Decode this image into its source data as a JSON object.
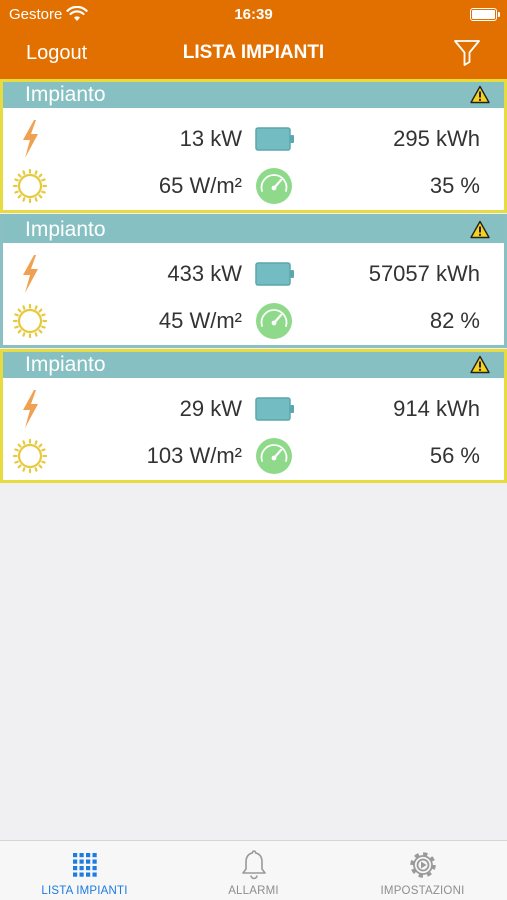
{
  "status_bar": {
    "carrier": "Gestore",
    "time": "16:39"
  },
  "header": {
    "logout_label": "Logout",
    "title": "LISTA IMPIANTI"
  },
  "colors": {
    "header_bg": "#e27000",
    "card_header_bg": "#86c0c3",
    "card_border_warning": "#e6dc3f",
    "bolt": "#f0a052",
    "sun": "#e6c93c",
    "battery": "#73bcc1",
    "gauge": "#8fd98a",
    "tab_active": "#1e7be0"
  },
  "plants": [
    {
      "name": "Impianto",
      "power": "13 kW",
      "energy": "295 kWh",
      "irradiance": "65 W/m²",
      "performance": "35 %",
      "warning": true
    },
    {
      "name": "Impianto",
      "power": "433 kW",
      "energy": "57057 kWh",
      "irradiance": "45 W/m²",
      "performance": "82 %",
      "warning": true
    },
    {
      "name": "Impianto",
      "power": "29 kW",
      "energy": "914 kWh",
      "irradiance": "103 W/m²",
      "performance": "56 %",
      "warning": true
    }
  ],
  "tabbar": {
    "tabs": [
      {
        "label": "LISTA IMPIANTI",
        "icon": "grid-icon",
        "active": true
      },
      {
        "label": "ALLARMI",
        "icon": "bell-icon",
        "active": false
      },
      {
        "label": "IMPOSTAZIONI",
        "icon": "gear-icon",
        "active": false
      }
    ]
  }
}
